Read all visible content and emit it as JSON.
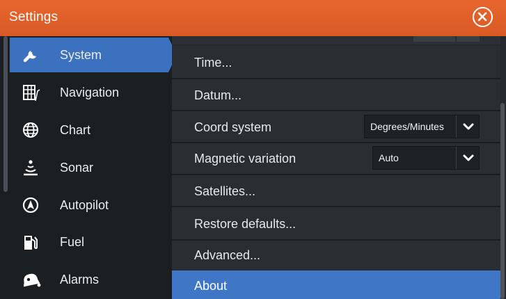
{
  "window": {
    "title": "Settings"
  },
  "sidebar": {
    "items": [
      {
        "label": "System",
        "icon": "wrench-icon"
      },
      {
        "label": "Navigation",
        "icon": "navigation-icon"
      },
      {
        "label": "Chart",
        "icon": "globe-icon"
      },
      {
        "label": "Sonar",
        "icon": "sonar-icon"
      },
      {
        "label": "Autopilot",
        "icon": "autopilot-icon"
      },
      {
        "label": "Fuel",
        "icon": "fuel-pump-icon"
      },
      {
        "label": "Alarms",
        "icon": "alarm-bell-icon"
      }
    ],
    "selected": "System"
  },
  "main": {
    "rows": [
      {
        "label": "Time..."
      },
      {
        "label": "Datum..."
      },
      {
        "label": "Coord system",
        "value": "Degrees/Minutes"
      },
      {
        "label": "Magnetic variation",
        "value": "Auto"
      },
      {
        "label": "Satellites..."
      },
      {
        "label": "Restore defaults..."
      },
      {
        "label": "Advanced..."
      },
      {
        "label": "About"
      }
    ]
  },
  "colors": {
    "titlebar": "#e0602a",
    "accent": "#3f77c6",
    "background": "#1b1e21"
  }
}
